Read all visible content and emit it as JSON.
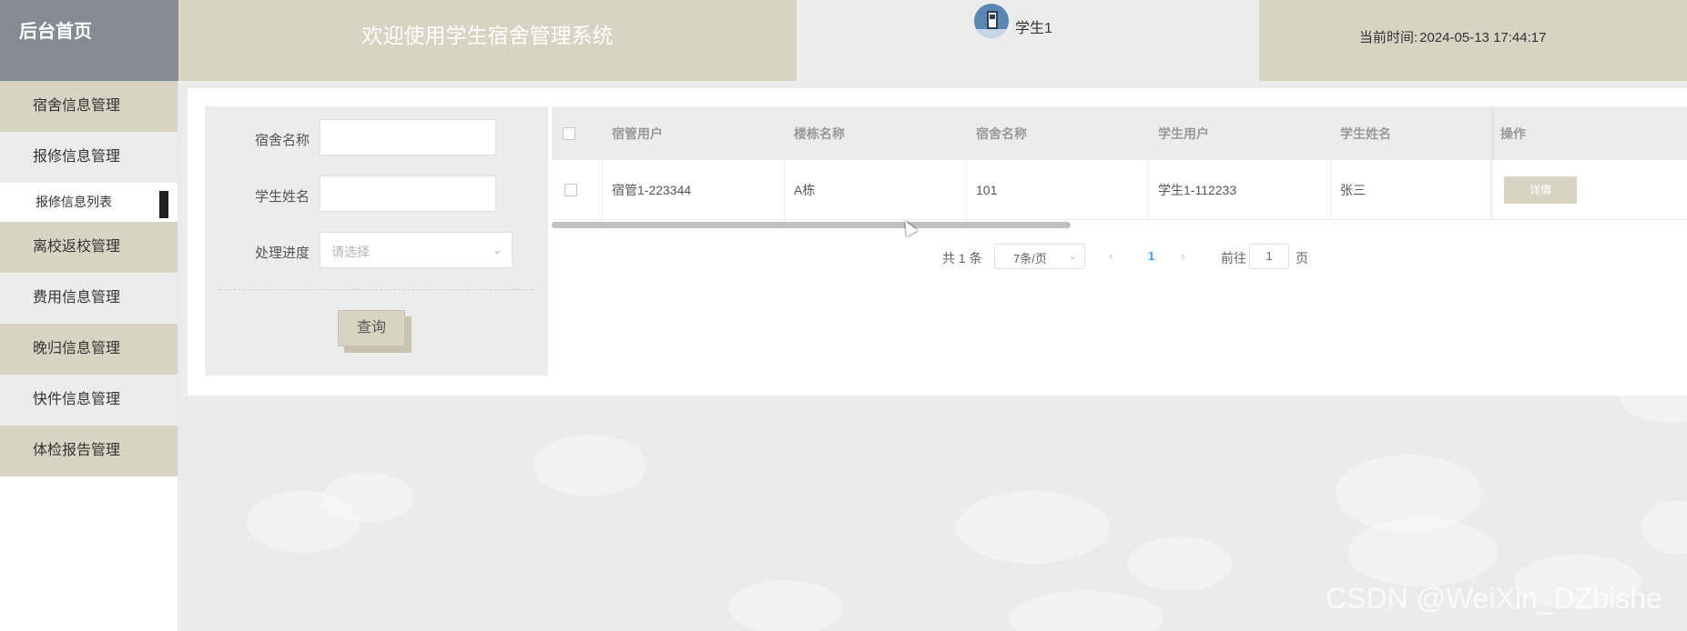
{
  "header": {
    "brand": "后台首页",
    "system_title": "欢迎使用学生宿舍管理系统",
    "username": "学生1",
    "time_label": "当前时间:",
    "time_value": "2024-05-13 17:44:17"
  },
  "sidebar": {
    "items": [
      {
        "label": "宿舍信息管理"
      },
      {
        "label": "报修信息管理"
      },
      {
        "label": "报修信息列表"
      },
      {
        "label": "离校返校管理"
      },
      {
        "label": "费用信息管理"
      },
      {
        "label": "晚归信息管理"
      },
      {
        "label": "快件信息管理"
      },
      {
        "label": "体检报告管理"
      }
    ]
  },
  "search": {
    "dorm_name_label": "宿舍名称",
    "dorm_name_value": "",
    "student_name_label": "学生姓名",
    "student_name_value": "",
    "progress_label": "处理进度",
    "progress_placeholder": "请选择",
    "query_button": "查询"
  },
  "table": {
    "columns": [
      "宿管用户",
      "楼栋名称",
      "宿舍名称",
      "学生用户",
      "学生姓名",
      "操作"
    ],
    "rows": [
      {
        "manager": "宿管1-223344",
        "building": "A栋",
        "dorm": "101",
        "student_user": "学生1-112233",
        "student_name": "张三",
        "action": "详情"
      }
    ]
  },
  "pagination": {
    "total": "共 1 条",
    "page_size": "7条/页",
    "current_page": "1",
    "goto_label": "前往",
    "goto_value": "1",
    "page_unit": "页"
  },
  "watermark": "CSDN @WeiXin_DZbishe",
  "colors": {
    "accent": "#d9d3c3",
    "brand_bg": "#858b92",
    "page_bg": "#ebebeb",
    "active_page": "#409eff"
  },
  "icons": {
    "avatar": "user-avatar-icon",
    "select_arrow": "chevron-down-icon",
    "prev": "chevron-left-icon",
    "next": "chevron-right-icon"
  }
}
